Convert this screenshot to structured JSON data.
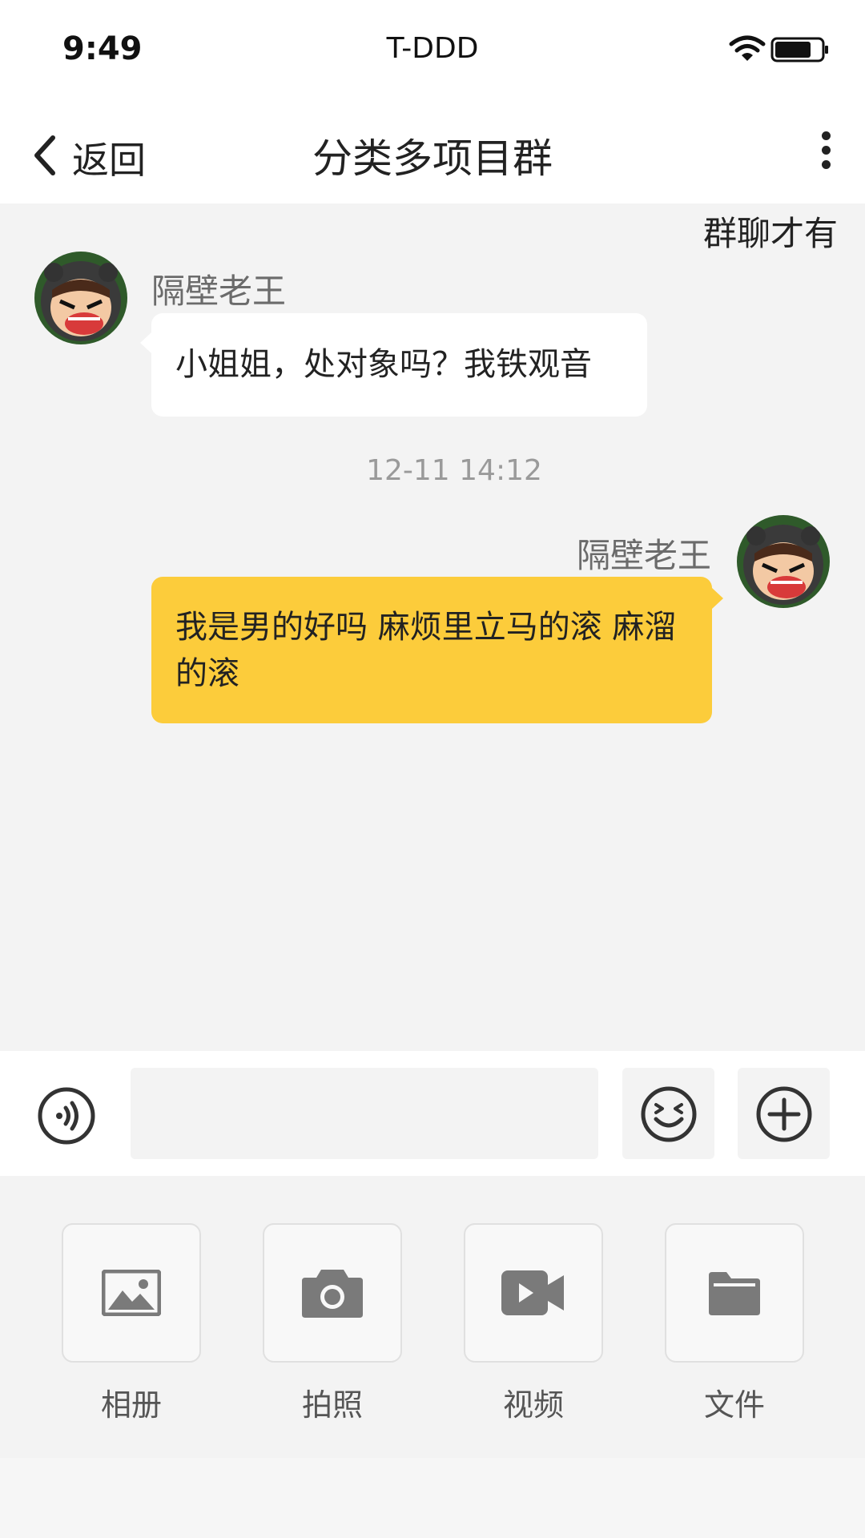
{
  "status_bar": {
    "time": "9:49",
    "carrier": "T-DDD"
  },
  "nav": {
    "back_label": "返回",
    "title": "分类多项目群"
  },
  "chat": {
    "group_hint": "群聊才有",
    "timestamp": "12-11 14:12",
    "messages": [
      {
        "direction": "incoming",
        "sender": "隔壁老王",
        "text": "小姐姐，处对象吗？我铁观音"
      },
      {
        "direction": "outgoing",
        "sender": "隔壁老王",
        "text": "我是男的好吗 麻烦里立马的滚 麻溜的滚"
      }
    ]
  },
  "input_bar": {
    "placeholder": "",
    "value": ""
  },
  "panel": {
    "tools": [
      {
        "label": "相册",
        "icon": "image-icon"
      },
      {
        "label": "拍照",
        "icon": "camera-icon"
      },
      {
        "label": "视频",
        "icon": "video-icon"
      },
      {
        "label": "文件",
        "icon": "folder-icon"
      }
    ]
  },
  "colors": {
    "outgoing_bubble": "#fccc3b",
    "incoming_bubble": "#ffffff",
    "background": "#f3f3f3"
  }
}
